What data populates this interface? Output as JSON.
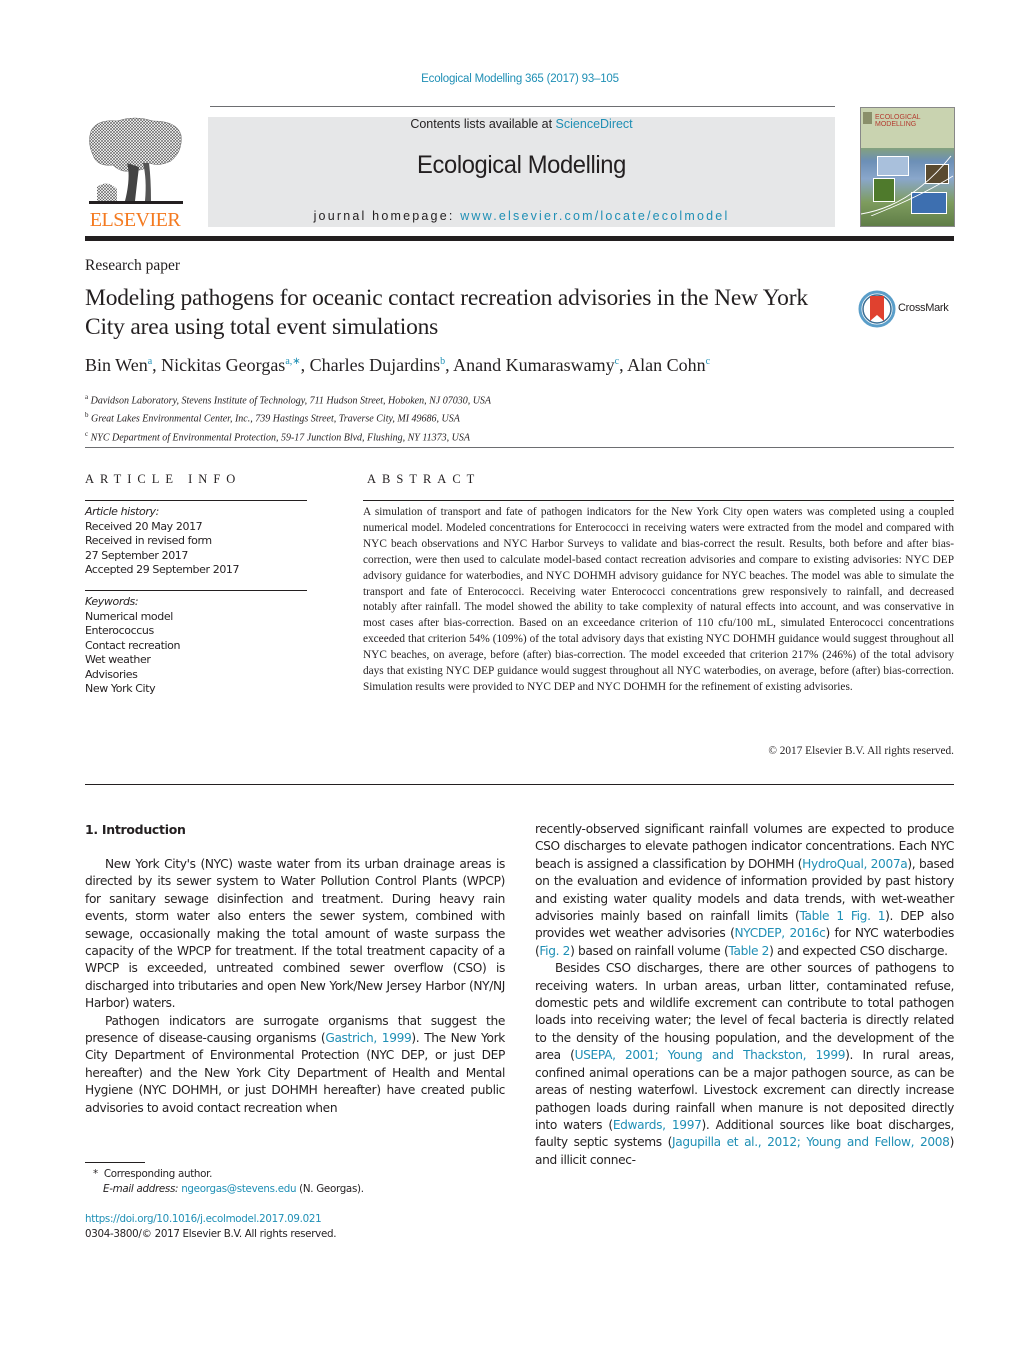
{
  "header": {
    "journal_ref": "Ecological Modelling 365 (2017) 93–105",
    "contents_prefix": "Contents lists available at ",
    "contents_link": "ScienceDirect",
    "journal_title": "Ecological Modelling",
    "homepage_prefix": "journal homepage: ",
    "homepage_link": "www.elsevier.com/locate/ecolmodel",
    "publisher_logo_text": "ELSEVIER",
    "cover_title_line1": "ECOLOGICAL",
    "cover_title_line2": "MODELLING",
    "crossmark_label": "CrossMark"
  },
  "colors": {
    "link": "#1f8fb5",
    "elsevier_orange": "#f47a20",
    "masthead_bg": "#e6e7e8",
    "text": "#231f20"
  },
  "article": {
    "type": "Research paper",
    "title": "Modeling pathogens for oceanic contact recreation advisories in the New York City area using total event simulations",
    "authors": [
      {
        "name": "Bin Wen",
        "aff": "a"
      },
      {
        "name": "Nickitas Georgas",
        "aff": "a,∗"
      },
      {
        "name": "Charles Dujardins",
        "aff": "b"
      },
      {
        "name": "Anand Kumaraswamy",
        "aff": "c"
      },
      {
        "name": "Alan Cohn",
        "aff": "c"
      }
    ],
    "affiliations": [
      {
        "key": "a",
        "text": "Davidson Laboratory, Stevens Institute of Technology, 711 Hudson Street, Hoboken, NJ 07030, USA"
      },
      {
        "key": "b",
        "text": "Great Lakes Environmental Center, Inc., 739 Hastings Street, Traverse City, MI 49686, USA"
      },
      {
        "key": "c",
        "text": "NYC Department of Environmental Protection, 59-17 Junction Blvd, Flushing, NY 11373, USA"
      }
    ]
  },
  "article_info": {
    "heading": "ARTICLE INFO",
    "history_label": "Article history:",
    "history": [
      "Received 20 May 2017",
      "Received in revised form",
      "27 September 2017",
      "Accepted 29 September 2017"
    ],
    "keywords_label": "Keywords:",
    "keywords": [
      "Numerical model",
      "Enterococcus",
      "Contact recreation",
      "Wet weather",
      "Advisories",
      "New York City"
    ]
  },
  "abstract": {
    "heading": "ABSTRACT",
    "text": "A simulation of transport and fate of pathogen indicators for the New York City open waters was completed using a coupled numerical model. Modeled concentrations for Enterococci in receiving waters were extracted from the model and compared with NYC beach observations and NYC Harbor Surveys to validate and bias-correct the result. Results, both before and after bias-correction, were then used to calculate model-based contact recreation advisories and compare to existing advisories: NYC DEP advisory guidance for waterbodies, and NYC DOHMH advisory guidance for NYC beaches. The model was able to simulate the transport and fate of Enterococci. Receiving water Enterococci concentrations grew responsively to rainfall, and decreased notably after rainfall. The model showed the ability to take complexity of natural effects into account, and was conservative in most cases after bias-correction. Based on an exceedance criterion of 110 cfu/100 mL, simulated Enterococci concentrations exceeded that criterion 54% (109%) of the total advisory days that existing NYC DOHMH guidance would suggest throughout all NYC beaches, on average, before (after) bias-correction. The model exceeded that criterion 217% (246%) of the total advisory days that existing NYC DEP guidance would suggest throughout all NYC waterbodies, on average, before (after) bias-correction. Simulation results were provided to NYC DEP and NYC DOHMH for the refinement of existing advisories.",
    "copyright": "© 2017 Elsevier B.V. All rights reserved."
  },
  "body": {
    "section_heading": "1.  Introduction",
    "left": {
      "p1": "New York City's (NYC) waste water from its urban drainage areas is directed by its sewer system to Water Pollution Control Plants (WPCP) for sanitary sewage disinfection and treatment. During heavy rain events, storm water also enters the sewer system, combined with sewage, occasionally making the total amount of waste surpass the capacity of the WPCP for treatment. If the total treatment capacity of a WPCP is exceeded, untreated combined sewer overflow (CSO) is discharged into tributaries and open New York/New Jersey Harbor (NY/NJ Harbor) waters.",
      "p2_a": "Pathogen indicators are surrogate organisms that suggest the presence of disease-causing organisms (",
      "p2_ref1": "Gastrich, 1999",
      "p2_b": "). The New York City Department of Environmental Protection (NYC DEP, or just DEP hereafter) and the New York City Department of Health and Mental Hygiene (NYC DOHMH, or just DOHMH hereafter) have created public advisories to avoid contact recreation when"
    },
    "right": {
      "p1_a": "recently-observed significant rainfall volumes are expected to produce CSO discharges to elevate pathogen indicator concentrations. Each NYC beach is assigned a classification by DOHMH (",
      "p1_ref1": "HydroQual, 2007a",
      "p1_b": "), based on the evaluation and evidence of information provided by past history and existing water quality models and data trends, with wet-weather advisories mainly based on rainfall limits (",
      "p1_ref2": "Table 1 Fig. 1",
      "p1_c": "). DEP also provides wet weather advisories (",
      "p1_ref3": "NYCDEP, 2016c",
      "p1_d": ") for NYC waterbodies (",
      "p1_ref4": "Fig. 2",
      "p1_e": ") based on rainfall volume (",
      "p1_ref5": "Table 2",
      "p1_f": ") and expected CSO discharge.",
      "p2_a": "Besides CSO discharges, there are other sources of pathogens to receiving waters. In urban areas, urban litter, contaminated refuse, domestic pets and wildlife excrement can contribute to total pathogen loads into receiving water; the level of fecal bacteria is directly related to the density of the housing population, and the development of the area (",
      "p2_ref1": "USEPA, 2001; Young and Thackston, 1999",
      "p2_b": "). In rural areas, confined animal operations can be a major pathogen source, as can be areas of nesting waterfowl. Livestock excrement can directly increase pathogen loads during rainfall when manure is not deposited directly into waters (",
      "p2_ref2": "Edwards, 1997",
      "p2_c": "). Additional sources like boat discharges, faulty septic systems (",
      "p2_ref3": "Jagupilla et al., 2012; Young and Fellow, 2008",
      "p2_d": ") and illicit connec-"
    }
  },
  "footnotes": {
    "corresponding_mark": "*",
    "corresponding_text": "Corresponding author.",
    "email_label": "E-mail address:",
    "email": "ngeorgas@stevens.edu",
    "email_suffix": " (N. Georgas).",
    "doi": "https://doi.org/10.1016/j.ecolmodel.2017.09.021",
    "issn_copyright": "0304-3800/© 2017 Elsevier B.V. All rights reserved."
  }
}
